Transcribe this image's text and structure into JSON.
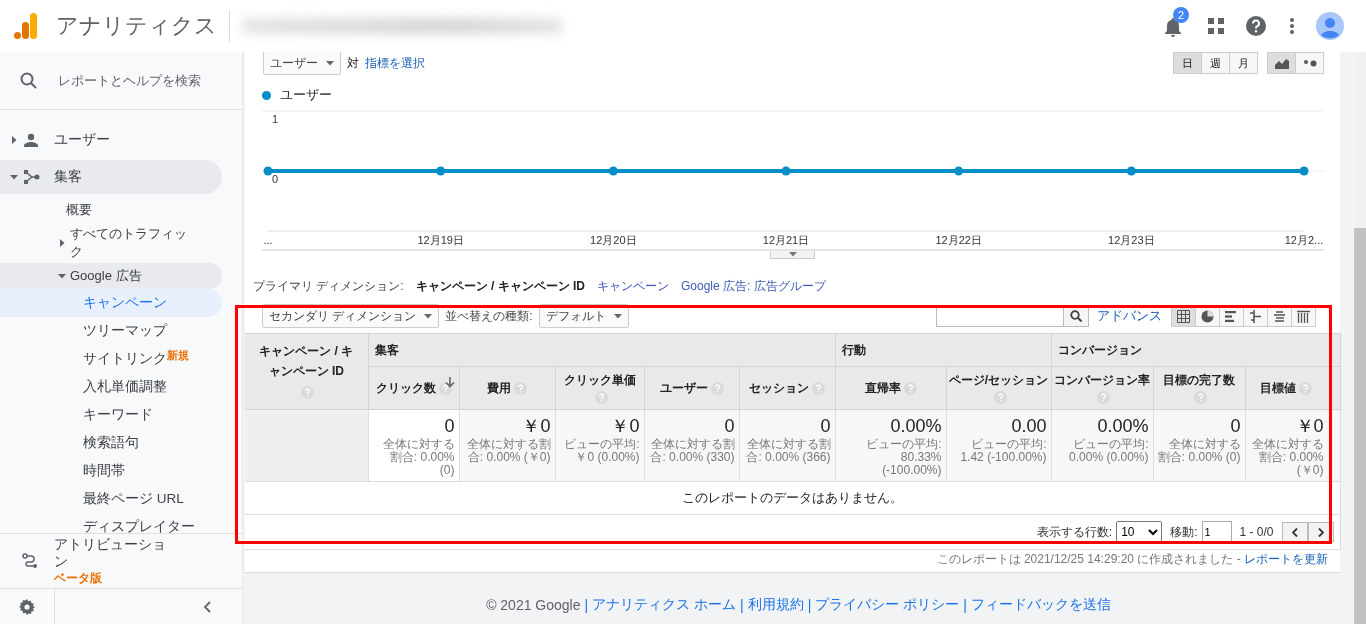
{
  "header": {
    "product_name": "アナリティクス",
    "notification_count": "2"
  },
  "sidebar": {
    "search_label": "レポートとヘルプを検索",
    "items": [
      {
        "kind": "audience",
        "label": "ユーザー",
        "expanded": false
      },
      {
        "kind": "acquisition",
        "label": "集客",
        "expanded": true,
        "children": [
          {
            "label": "概要",
            "selected": false
          },
          {
            "label": "すべてのトラフィック",
            "expanded": false
          },
          {
            "label": "Google 広告",
            "expanded": true,
            "children": [
              {
                "label": "キャンペーン",
                "selected": true
              },
              {
                "label": "ツリーマップ",
                "selected": false
              },
              {
                "label": "サイトリンク",
                "badge": "新規",
                "selected": false
              },
              {
                "label": "入札単価調整",
                "selected": false
              },
              {
                "label": "キーワード",
                "selected": false
              },
              {
                "label": "検索語句",
                "selected": false
              },
              {
                "label": "時間帯",
                "selected": false
              },
              {
                "label": "最終ページ URL",
                "selected": false
              },
              {
                "label": "ディスプレイター",
                "selected": false
              }
            ]
          }
        ]
      }
    ],
    "attribution": {
      "label": "アトリビューション",
      "badge": "ベータ版"
    }
  },
  "chart_controls": {
    "metric": "ユーザー",
    "versus": "対",
    "metric_link": "指標を選択",
    "intervals": [
      {
        "label": "日",
        "selected": true
      },
      {
        "label": "週",
        "selected": false
      },
      {
        "label": "月",
        "selected": false
      }
    ],
    "chart_types": [
      {
        "kind": "line",
        "selected": true
      },
      {
        "kind": "motion",
        "selected": false
      }
    ]
  },
  "chart": {
    "chart_data": {
      "type": "line",
      "categories": [
        "...",
        "12月19日",
        "12月20日",
        "12月21日",
        "12月22日",
        "12月23日",
        "12月2..."
      ],
      "series": [
        {
          "name": "ユーザー",
          "color": "#058dc7",
          "marker": "o",
          "values": [
            0,
            0,
            0,
            0,
            0,
            0,
            0
          ]
        }
      ],
      "ylim": [
        -1,
        1
      ],
      "yticks": [
        0,
        1
      ]
    }
  },
  "report": {
    "primary_dimension": {
      "label": "プライマリ ディメンション:",
      "options": [
        {
          "label": "キャンペーン / キャンペーン ID",
          "selected": true
        },
        {
          "label": "キャンペーン",
          "selected": false
        },
        {
          "label": "Google 広告: 広告グループ",
          "selected": false
        }
      ]
    },
    "toolbar": {
      "secondary_dimension": "セカンダリ ディメンション",
      "sort_label": "並べ替えの種類:",
      "sort_value": "デフォルト",
      "advanced_link": "アドバンス",
      "views": [
        {
          "kind": "table",
          "selected": true
        },
        {
          "kind": "pie",
          "selected": false
        },
        {
          "kind": "performance",
          "selected": false
        },
        {
          "kind": "comparison",
          "selected": false
        },
        {
          "kind": "term-cloud",
          "selected": false
        },
        {
          "kind": "pivot",
          "selected": false
        }
      ]
    },
    "table": {
      "dimension_column": "キャンペーン / キャンペーン ID",
      "groups": [
        {
          "label": "集客",
          "columns": [
            {
              "label": "クリック数",
              "sorted": true,
              "total": "0",
              "note": "全体に対する割合: 0.00% (0)"
            },
            {
              "label": "費用",
              "sorted": false,
              "total": "￥0",
              "note": "全体に対する割合: 0.00% (￥0)"
            },
            {
              "label": "クリック単価",
              "sorted": false,
              "total": "￥0",
              "note": "ビューの平均: ￥0 (0.00%)"
            },
            {
              "label": "ユーザー",
              "sorted": false,
              "total": "0",
              "note": "全体に対する割合: 0.00% (330)"
            },
            {
              "label": "セッション",
              "sorted": false,
              "total": "0",
              "note": "全体に対する割合: 0.00% (366)"
            }
          ]
        },
        {
          "label": "行動",
          "columns": [
            {
              "label": "直帰率",
              "sorted": false,
              "total": "0.00%",
              "note": "ビューの平均: 80.33% (-100.00%)"
            },
            {
              "label": "ページ/セッション",
              "sorted": false,
              "total": "0.00",
              "note": "ビューの平均: 1.42 (-100.00%)"
            }
          ]
        },
        {
          "label": "コンバージョン",
          "columns": [
            {
              "label": "コンバージョン率",
              "sorted": false,
              "total": "0.00%",
              "note": "ビューの平均: 0.00% (0.00%)"
            },
            {
              "label": "目標の完了数",
              "sorted": false,
              "total": "0",
              "note": "全体に対する割合: 0.00% (0)"
            },
            {
              "label": "目標値",
              "sorted": false,
              "total": "￥0",
              "note": "全体に対する割合: 0.00% (￥0)"
            }
          ]
        }
      ],
      "empty_message": "このレポートのデータはありません。"
    },
    "pager": {
      "rows_label": "表示する行数:",
      "rows_value": "10",
      "goto_label": "移動:",
      "goto_value": "1",
      "range": "1 - 0/0"
    },
    "timestamp": "このレポートは 2021/12/25 14:29:20 に作成されました -",
    "refresh_link": "レポートを更新"
  },
  "footer": {
    "copyright": "© 2021 Google",
    "separator": "|",
    "links": [
      "アナリティクス ホーム",
      "利用規約",
      "プライバシー ポリシー",
      "フィードバックを送信"
    ]
  }
}
